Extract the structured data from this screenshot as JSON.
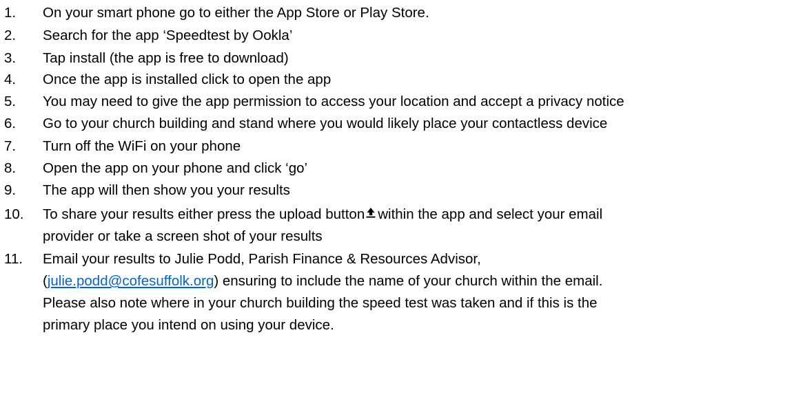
{
  "steps": [
    {
      "num": "1.",
      "text": "On your smart phone go to either the App Store or Play Store."
    },
    {
      "num": "2.",
      "text": "Search for the app ‘Speedtest by Ookla’"
    },
    {
      "num": "3.",
      "text": "Tap install (the app is free to download)"
    },
    {
      "num": "4.",
      "text": "Once the app is installed click to open the app"
    },
    {
      "num": "5.",
      "text": "You may need to give the app permission to access your location and accept a privacy notice"
    },
    {
      "num": "6.",
      "text": "Go to your church building and stand where you would likely place your contactless device"
    },
    {
      "num": "7.",
      "text": "Turn off the WiFi on your phone"
    },
    {
      "num": "8.",
      "text": "Open the app on your phone and click ‘go’"
    },
    {
      "num": "9.",
      "text": "The app will then show you your results"
    },
    {
      "num": "10.",
      "text_before_icon": "To share your results either press the upload button",
      "text_after_icon": "within the app and select your email",
      "line2": "provider or take a screen shot of your results",
      "icon": "upload-icon"
    },
    {
      "num": "11.",
      "line1": "Email your results to Julie Podd, Parish Finance & Resources Advisor,",
      "line2_open": "(",
      "email": "julie.podd@cofesuffolk.org",
      "line2_close": ") ensuring to include the name of your church within the email.",
      "line3": "Please also note where in your church building the speed test was taken and if this is the",
      "line4": "primary place you intend on using your device."
    }
  ],
  "colors": {
    "text": "#000000",
    "link": "#0563c1",
    "background": "#ffffff"
  }
}
